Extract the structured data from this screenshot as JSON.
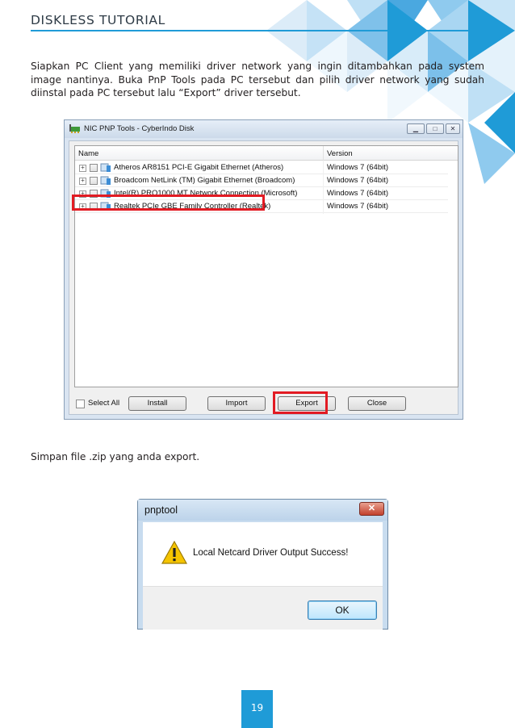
{
  "header": {
    "title": "DISKLESS TUTORIAL",
    "accent_color": "#1f9bd7"
  },
  "paragraphs": {
    "intro": "Siapkan PC Client yang memiliki driver network yang ingin ditambahkan pada system image nantinya. Buka PnP Tools pada PC tersebut dan pilih driver network yang sudah diinstal pada PC tersebut lalu “Export” driver tersebut.",
    "save": "Simpan file .zip yang anda export."
  },
  "pnp_window": {
    "title": "NIC PNP Tools - CyberIndo Disk",
    "columns": [
      "Name",
      "Version"
    ],
    "drivers": [
      {
        "name": "Atheros AR8151 PCI-E Gigabit Ethernet (Atheros)",
        "version": "Windows 7 (64bit)"
      },
      {
        "name": "Broadcom NetLink (TM) Gigabit Ethernet (Broadcom)",
        "version": "Windows 7 (64bit)"
      },
      {
        "name": "Intel(R) PRO1000 MT Network Connection (Microsoft)",
        "version": "Windows 7 (64bit)"
      },
      {
        "name": "Realtek PCIe GBE Family Controller (Realtek)",
        "version": "Windows 7 (64bit)"
      }
    ],
    "highlighted_driver": "Realtek PCIe GBE Family Controller (Realtek)",
    "select_all_label": "Select All",
    "buttons": {
      "install": "Install",
      "import": "Import",
      "export": "Export",
      "close": "Close"
    },
    "highlight_color": "#e21b23"
  },
  "dialog": {
    "title": "pnptool",
    "close_glyph": "✕",
    "message": "Local Netcard Driver Output Success!",
    "ok_label": "OK",
    "icon": "warning-icon"
  },
  "footer": {
    "page_number": "19"
  }
}
